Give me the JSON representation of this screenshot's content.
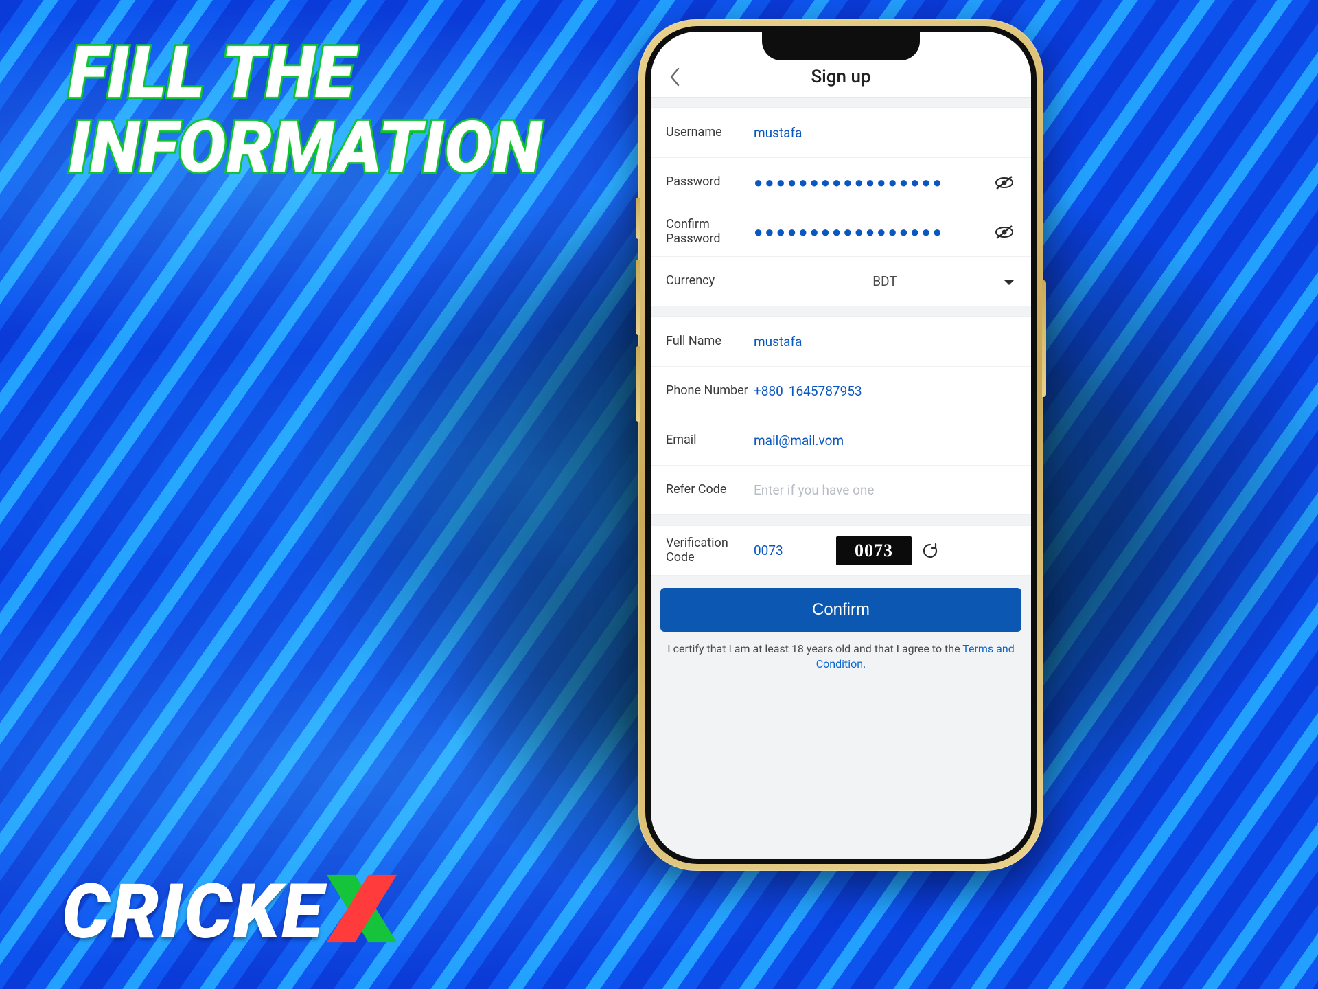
{
  "headline_line1": "FILL THE",
  "headline_line2": "INFORMATION",
  "brand_name": "CRICKEX",
  "appbar": {
    "title": "Sign up"
  },
  "labels": {
    "username": "Username",
    "password": "Password",
    "confirm_password": "Confirm Password",
    "currency": "Currency",
    "full_name": "Full Name",
    "phone": "Phone Number",
    "email": "Email",
    "refer_code": "Refer Code",
    "verification_code": "Verification Code"
  },
  "values": {
    "username": "mustafa",
    "password_mask": "●●●●●●●●●●●●●●●●●",
    "confirm_password_mask": "●●●●●●●●●●●●●●●●●",
    "currency": "BDT",
    "full_name": "mustafa",
    "phone_cc": "+880",
    "phone": "1645787953",
    "email": "mail@mail.vom",
    "refer_code": "",
    "verification_code": "0073",
    "captcha_image_text": "0073"
  },
  "placeholders": {
    "refer_code": "Enter if you have one"
  },
  "buttons": {
    "confirm": "Confirm"
  },
  "disclaimer": {
    "prefix": "I certify that I am at least 18 years old and that I agree to the ",
    "link": "Terms and Condition.",
    "suffix": ""
  }
}
